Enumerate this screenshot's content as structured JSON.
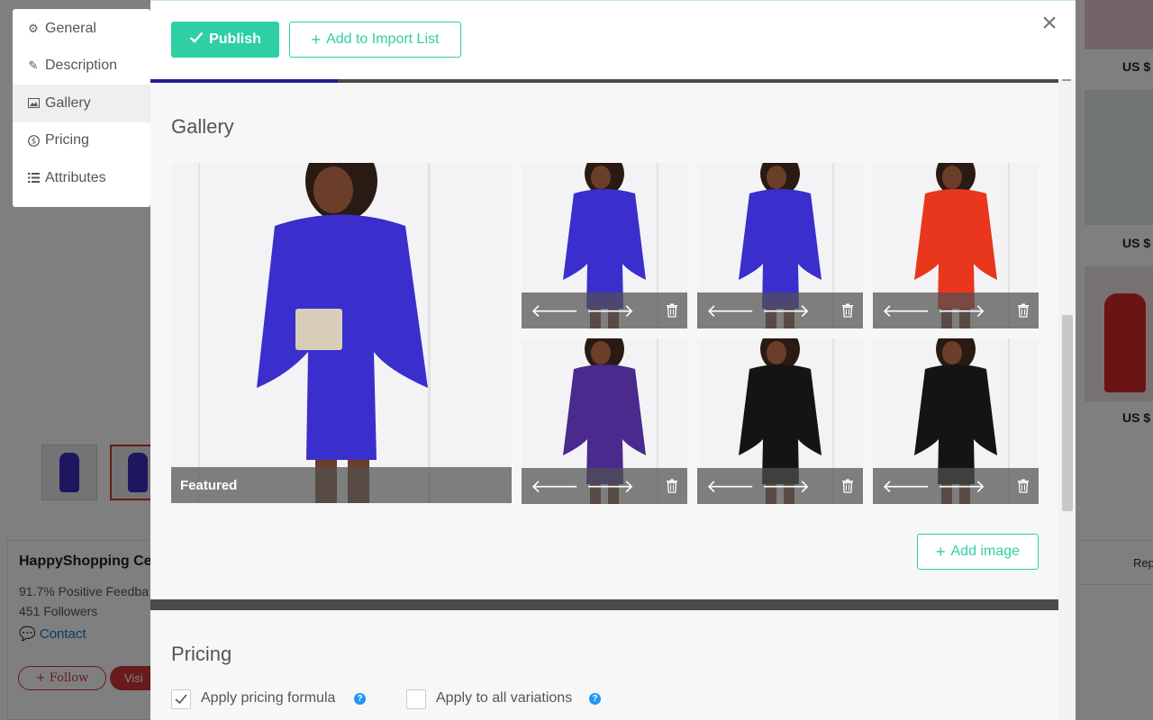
{
  "sidebar": {
    "items": [
      {
        "label": "General",
        "icon": "gear-icon"
      },
      {
        "label": "Description",
        "icon": "pencil-icon"
      },
      {
        "label": "Gallery",
        "icon": "image-icon",
        "active": true
      },
      {
        "label": "Pricing",
        "icon": "dollar-icon"
      },
      {
        "label": "Attributes",
        "icon": "list-icon"
      }
    ]
  },
  "toolbar": {
    "publish_label": "Publish",
    "import_label": "Add to Import List"
  },
  "gallery": {
    "title": "Gallery",
    "featured_label": "Featured",
    "add_image_label": "Add image",
    "images": [
      {
        "dress_color": "#3a2fcc"
      },
      {
        "dress_color": "#3a2fcc"
      },
      {
        "dress_color": "#e8371c"
      },
      {
        "dress_color": "#4a2a8c"
      },
      {
        "dress_color": "#141414"
      },
      {
        "dress_color": "#141414"
      }
    ]
  },
  "pricing": {
    "title": "Pricing",
    "apply_formula_label": "Apply pricing formula",
    "apply_all_label": "Apply to all variations",
    "apply_formula_checked": true,
    "apply_all_checked": false
  },
  "background": {
    "store_name": "HappyShopping Ce",
    "feedback": "91.7% Positive Feedba",
    "followers": "451 Followers",
    "contact": "Contact",
    "follow": "+ Follow",
    "visit": "Visi",
    "price_label": "US $",
    "report": "Rep"
  },
  "colors": {
    "accent": "#2ecfa4",
    "help": "#2196f3"
  }
}
